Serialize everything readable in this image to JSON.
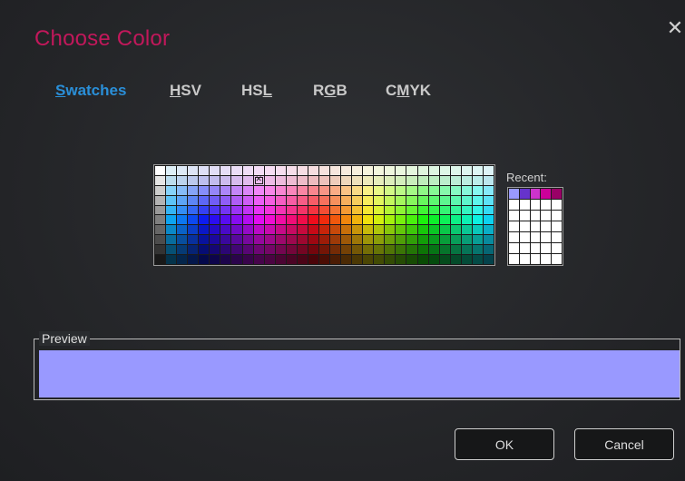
{
  "dialog": {
    "title": "Choose Color",
    "close_glyph": "✕",
    "accent_color": "#c2185b"
  },
  "tabs": [
    {
      "pre": "",
      "ul": "S",
      "post": "watches",
      "active": true
    },
    {
      "pre": "",
      "ul": "H",
      "post": "SV",
      "active": false
    },
    {
      "pre": "HS",
      "ul": "L",
      "post": "",
      "active": false
    },
    {
      "pre": "R",
      "ul": "G",
      "post": "B",
      "active": false
    },
    {
      "pre": "C",
      "ul": "M",
      "post": "YK",
      "active": false
    }
  ],
  "swatches": {
    "columns": 31,
    "rows": 10,
    "selected": {
      "row": 1,
      "col": 9
    }
  },
  "recent": {
    "label": "Recent:",
    "colors": [
      "#9999ff",
      "#6633cc",
      "#cc33cc",
      "#cc0099",
      "#990066"
    ]
  },
  "preview": {
    "label": "Preview",
    "color": "#9999ff"
  },
  "buttons": {
    "ok": "OK",
    "cancel": "Cancel"
  }
}
